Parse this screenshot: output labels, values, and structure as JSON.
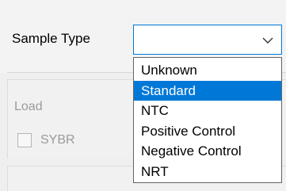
{
  "sample_type": {
    "label": "Sample Type",
    "selected_value": "",
    "options": [
      "Unknown",
      "Standard",
      "NTC",
      "Positive Control",
      "Negative Control",
      "NRT"
    ],
    "highlighted_option": "Standard"
  },
  "load_group": {
    "label": "Load",
    "checkbox_label": "SYBR",
    "checkbox_checked": false,
    "disabled": true
  },
  "icons": {
    "dropdown": "chevron-down-icon"
  },
  "colors": {
    "accent": "#0078d7",
    "disabled_text": "#9b9b9b",
    "background": "#efefef"
  }
}
